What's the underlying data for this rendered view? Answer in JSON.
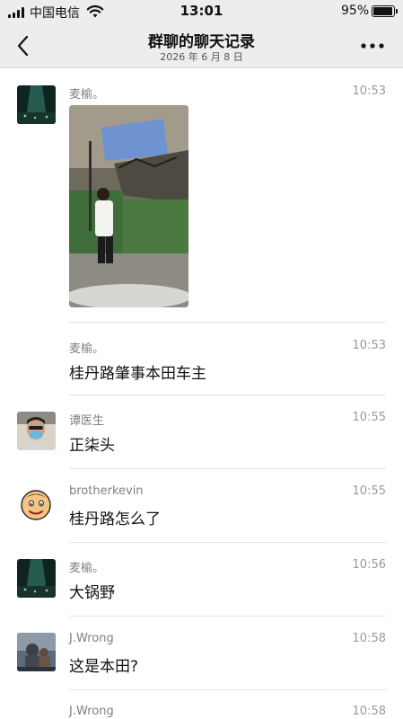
{
  "status": {
    "carrier": "中国电信",
    "time": "13:01",
    "battery": "95%",
    "battery_level": 0.95
  },
  "nav": {
    "title": "群聊的聊天记录",
    "subtitle": "2026 年 6 月 8 日"
  },
  "messages": [
    {
      "sender": "麦榆。",
      "time": "10:53",
      "type": "image"
    },
    {
      "sender": "麦榆。",
      "time": "10:53",
      "text": "桂丹路肇事本田车主"
    },
    {
      "sender": "谭医生",
      "time": "10:55",
      "text": "正柒头"
    },
    {
      "sender": "brotherkevin",
      "time": "10:55",
      "text": "桂丹路怎么了"
    },
    {
      "sender": "麦榆。",
      "time": "10:56",
      "text": "大锅野"
    },
    {
      "sender": "J.Wrong",
      "time": "10:58",
      "text": "这是本田?"
    },
    {
      "sender": "J.Wrong",
      "time": "10:58"
    }
  ],
  "colors": {
    "header_bg": "#ededed",
    "secondary_text": "#7f7f7f"
  }
}
